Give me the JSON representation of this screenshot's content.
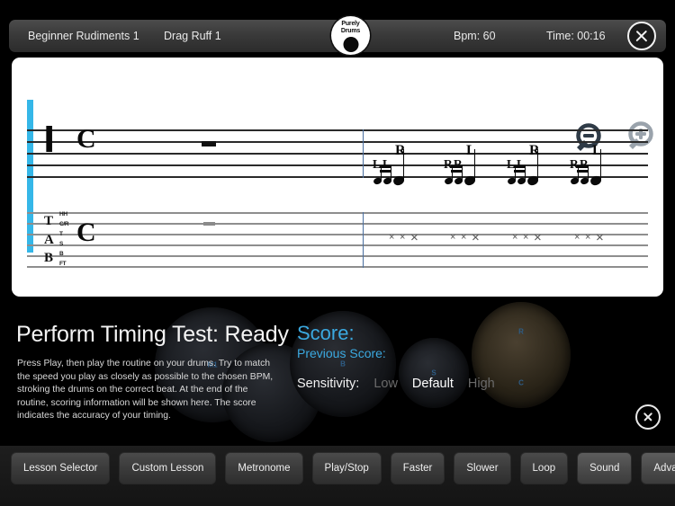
{
  "header": {
    "lesson": "Beginner Rudiments 1",
    "routine": "Drag Ruff 1",
    "bpm": "Bpm: 60",
    "time": "Time: 00:16",
    "logo_line1": "Purely",
    "logo_line2": "Drums",
    "close_icon": "close-circle-icon"
  },
  "sheet": {
    "percussion_clef": "percussion-clef",
    "time_signature": "C",
    "tab_letters": [
      "T",
      "A",
      "B"
    ],
    "drum_labels": [
      "HH",
      "C/R",
      "T",
      "S",
      "B",
      "FT"
    ],
    "zoom_out_icon": "magnifier-minus-icon",
    "zoom_in_icon": "magnifier-plus-icon",
    "prev_icon": "chevron-left-icon",
    "next_icon": "chevron-right-icon",
    "cursor_color": "#35b7e8",
    "note_groups": [
      {
        "sticking": [
          "L",
          "L",
          "R"
        ]
      },
      {
        "sticking": [
          "R",
          "R",
          "L"
        ]
      },
      {
        "sticking": [
          "L",
          "L",
          "R"
        ]
      },
      {
        "sticking": [
          "R",
          "R",
          "L"
        ]
      }
    ]
  },
  "panel": {
    "title": "Perform Timing Test: Ready",
    "description": "Press Play, then play the routine on your drums. Try to match the speed you play as closely as possible to the chosen BPM, stroking the drums on the correct beat. At the end of the routine, scoring information will be shown here. The score indicates the accuracy of your timing.",
    "score_label": "Score:",
    "previous_score_label": "Previous Score:",
    "sensitivity_label": "Sensitivity:",
    "sensitivity_options": [
      "Low",
      "Default",
      "High"
    ],
    "sensitivity_selected": "Default",
    "accent_color": "#3ba9e0",
    "close_icon": "close-circle-icon",
    "drum_labels": [
      "M1",
      "B",
      "S",
      "R",
      "C"
    ]
  },
  "toolbar": {
    "buttons": [
      {
        "label": "Lesson Selector",
        "highlight": false
      },
      {
        "label": "Custom Lesson",
        "highlight": false
      },
      {
        "label": "Metronome",
        "highlight": false
      },
      {
        "label": "Play/Stop",
        "highlight": false
      },
      {
        "label": "Faster",
        "highlight": false
      },
      {
        "label": "Slower",
        "highlight": false
      },
      {
        "label": "Loop",
        "highlight": false
      },
      {
        "label": "Sound",
        "highlight": true
      },
      {
        "label": "Advanced",
        "highlight": true
      }
    ]
  }
}
